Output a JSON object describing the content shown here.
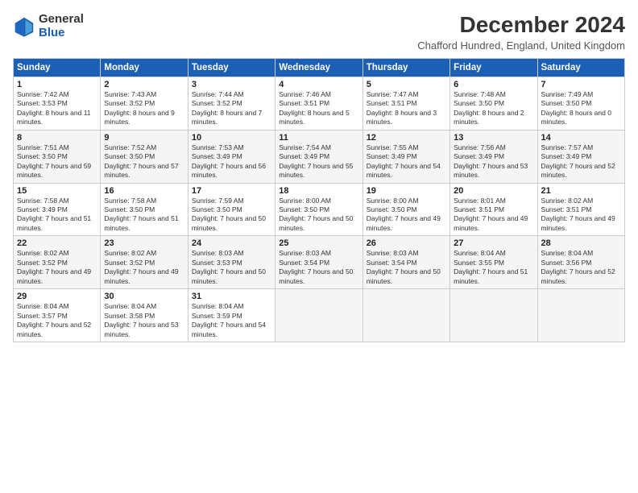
{
  "logo": {
    "general": "General",
    "blue": "Blue"
  },
  "title": "December 2024",
  "location": "Chafford Hundred, England, United Kingdom",
  "weekdays": [
    "Sunday",
    "Monday",
    "Tuesday",
    "Wednesday",
    "Thursday",
    "Friday",
    "Saturday"
  ],
  "weeks": [
    [
      {
        "day": "1",
        "sunrise": "7:42 AM",
        "sunset": "3:53 PM",
        "daylight": "8 hours and 11 minutes."
      },
      {
        "day": "2",
        "sunrise": "7:43 AM",
        "sunset": "3:52 PM",
        "daylight": "8 hours and 9 minutes."
      },
      {
        "day": "3",
        "sunrise": "7:44 AM",
        "sunset": "3:52 PM",
        "daylight": "8 hours and 7 minutes."
      },
      {
        "day": "4",
        "sunrise": "7:46 AM",
        "sunset": "3:51 PM",
        "daylight": "8 hours and 5 minutes."
      },
      {
        "day": "5",
        "sunrise": "7:47 AM",
        "sunset": "3:51 PM",
        "daylight": "8 hours and 3 minutes."
      },
      {
        "day": "6",
        "sunrise": "7:48 AM",
        "sunset": "3:50 PM",
        "daylight": "8 hours and 2 minutes."
      },
      {
        "day": "7",
        "sunrise": "7:49 AM",
        "sunset": "3:50 PM",
        "daylight": "8 hours and 0 minutes."
      }
    ],
    [
      {
        "day": "8",
        "sunrise": "7:51 AM",
        "sunset": "3:50 PM",
        "daylight": "7 hours and 59 minutes."
      },
      {
        "day": "9",
        "sunrise": "7:52 AM",
        "sunset": "3:50 PM",
        "daylight": "7 hours and 57 minutes."
      },
      {
        "day": "10",
        "sunrise": "7:53 AM",
        "sunset": "3:49 PM",
        "daylight": "7 hours and 56 minutes."
      },
      {
        "day": "11",
        "sunrise": "7:54 AM",
        "sunset": "3:49 PM",
        "daylight": "7 hours and 55 minutes."
      },
      {
        "day": "12",
        "sunrise": "7:55 AM",
        "sunset": "3:49 PM",
        "daylight": "7 hours and 54 minutes."
      },
      {
        "day": "13",
        "sunrise": "7:56 AM",
        "sunset": "3:49 PM",
        "daylight": "7 hours and 53 minutes."
      },
      {
        "day": "14",
        "sunrise": "7:57 AM",
        "sunset": "3:49 PM",
        "daylight": "7 hours and 52 minutes."
      }
    ],
    [
      {
        "day": "15",
        "sunrise": "7:58 AM",
        "sunset": "3:49 PM",
        "daylight": "7 hours and 51 minutes."
      },
      {
        "day": "16",
        "sunrise": "7:58 AM",
        "sunset": "3:50 PM",
        "daylight": "7 hours and 51 minutes."
      },
      {
        "day": "17",
        "sunrise": "7:59 AM",
        "sunset": "3:50 PM",
        "daylight": "7 hours and 50 minutes."
      },
      {
        "day": "18",
        "sunrise": "8:00 AM",
        "sunset": "3:50 PM",
        "daylight": "7 hours and 50 minutes."
      },
      {
        "day": "19",
        "sunrise": "8:00 AM",
        "sunset": "3:50 PM",
        "daylight": "7 hours and 49 minutes."
      },
      {
        "day": "20",
        "sunrise": "8:01 AM",
        "sunset": "3:51 PM",
        "daylight": "7 hours and 49 minutes."
      },
      {
        "day": "21",
        "sunrise": "8:02 AM",
        "sunset": "3:51 PM",
        "daylight": "7 hours and 49 minutes."
      }
    ],
    [
      {
        "day": "22",
        "sunrise": "8:02 AM",
        "sunset": "3:52 PM",
        "daylight": "7 hours and 49 minutes."
      },
      {
        "day": "23",
        "sunrise": "8:02 AM",
        "sunset": "3:52 PM",
        "daylight": "7 hours and 49 minutes."
      },
      {
        "day": "24",
        "sunrise": "8:03 AM",
        "sunset": "3:53 PM",
        "daylight": "7 hours and 50 minutes."
      },
      {
        "day": "25",
        "sunrise": "8:03 AM",
        "sunset": "3:54 PM",
        "daylight": "7 hours and 50 minutes."
      },
      {
        "day": "26",
        "sunrise": "8:03 AM",
        "sunset": "3:54 PM",
        "daylight": "7 hours and 50 minutes."
      },
      {
        "day": "27",
        "sunrise": "8:04 AM",
        "sunset": "3:55 PM",
        "daylight": "7 hours and 51 minutes."
      },
      {
        "day": "28",
        "sunrise": "8:04 AM",
        "sunset": "3:56 PM",
        "daylight": "7 hours and 52 minutes."
      }
    ],
    [
      {
        "day": "29",
        "sunrise": "8:04 AM",
        "sunset": "3:57 PM",
        "daylight": "7 hours and 52 minutes."
      },
      {
        "day": "30",
        "sunrise": "8:04 AM",
        "sunset": "3:58 PM",
        "daylight": "7 hours and 53 minutes."
      },
      {
        "day": "31",
        "sunrise": "8:04 AM",
        "sunset": "3:59 PM",
        "daylight": "7 hours and 54 minutes."
      },
      null,
      null,
      null,
      null
    ]
  ]
}
